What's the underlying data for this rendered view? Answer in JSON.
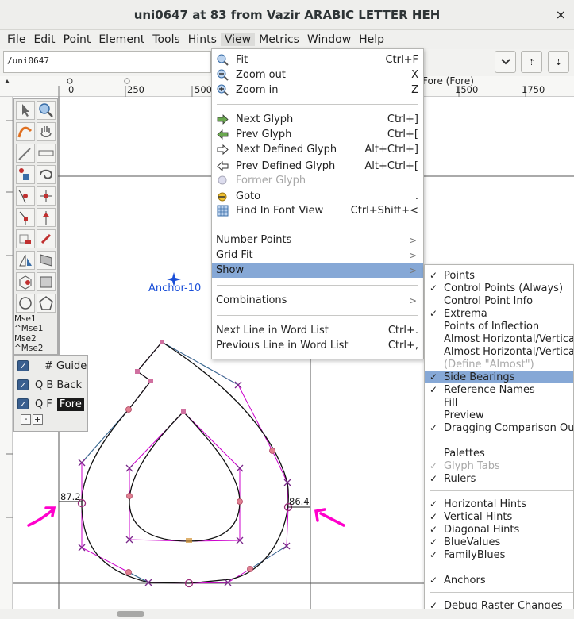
{
  "window": {
    "title": "uni0647 at 83 from Vazir ARABIC LETTER HEH",
    "close": "×"
  },
  "menubar": [
    "File",
    "Edit",
    "Point",
    "Element",
    "Tools",
    "Hints",
    "View",
    "Metrics",
    "Window",
    "Help"
  ],
  "toolbar": {
    "glyph_name": "/uni0647",
    "layer_label": "Fore (Fore)"
  },
  "ruler": {
    "top_ticks": [
      "0",
      "250",
      "500",
      "1500",
      "1750"
    ]
  },
  "palette": {
    "mse_lines": [
      "Mse1",
      "^Mse1",
      "Mse2",
      "^Mse2"
    ]
  },
  "layers": [
    {
      "label": "# Guide",
      "checked": true
    },
    {
      "label": "Q B  Back",
      "checked": true
    },
    {
      "label": "Q F",
      "tag": "Fore",
      "checked": true
    }
  ],
  "canvas": {
    "anchor_label": "Anchor-10",
    "left_bearing": "87.2",
    "right_bearing": "86.4"
  },
  "view_menu": [
    {
      "label": "Fit",
      "accel": "Ctrl+F",
      "icon": "zoom-fit-icon"
    },
    {
      "label": "Zoom out",
      "accel": "X",
      "icon": "zoom-out-icon"
    },
    {
      "label": "Zoom in",
      "accel": "Z",
      "icon": "zoom-in-icon"
    },
    {
      "label": "Next Glyph",
      "accel": "Ctrl+]",
      "icon": "next-glyph-icon"
    },
    {
      "label": "Prev Glyph",
      "accel": "Ctrl+[",
      "icon": "prev-glyph-icon"
    },
    {
      "label": "Next Defined Glyph",
      "accel": "Alt+Ctrl+]",
      "icon": "next-defined-glyph-icon"
    },
    {
      "label": "Prev Defined Glyph",
      "accel": "Alt+Ctrl+[",
      "icon": "prev-defined-glyph-icon"
    },
    {
      "label": "Former Glyph",
      "accel": "",
      "icon": "former-glyph-icon",
      "disabled": true
    },
    {
      "label": "Goto",
      "accel": ".",
      "icon": "goto-icon"
    },
    {
      "label": "Find In Font View",
      "accel": "Ctrl+Shift+<",
      "icon": "find-in-font-view-icon"
    },
    {
      "label": "Number Points",
      "submenu": true
    },
    {
      "label": "Grid Fit",
      "submenu": true
    },
    {
      "label": "Show",
      "submenu": true,
      "highlighted": true
    },
    {
      "label": "Combinations",
      "submenu": true
    },
    {
      "label": "Next Line in Word List",
      "accel": "Ctrl+."
    },
    {
      "label": "Previous Line in Word List",
      "accel": "Ctrl+,"
    }
  ],
  "show_menu": [
    {
      "label": "Points",
      "checked": true
    },
    {
      "label": "Control Points (Always)",
      "checked": true
    },
    {
      "label": "Control Point Info",
      "checked": false
    },
    {
      "label": "Extrema",
      "checked": true
    },
    {
      "label": "Points of Inflection",
      "checked": false
    },
    {
      "label": "Almost Horizontal/Vertical",
      "checked": false
    },
    {
      "label": "Almost Horizontal/Vertical",
      "checked": false
    },
    {
      "label": "(Define \"Almost\")",
      "checked": false,
      "disabled": true
    },
    {
      "label": "Side Bearings",
      "checked": true,
      "highlighted": true
    },
    {
      "label": "Reference Names",
      "checked": true
    },
    {
      "label": "Fill",
      "checked": false
    },
    {
      "label": "Preview",
      "checked": false
    },
    {
      "label": "Dragging Comparison Out",
      "checked": true
    },
    {
      "label": "Palettes",
      "checked": false
    },
    {
      "label": "Glyph Tabs",
      "checked": true,
      "disabled": true
    },
    {
      "label": "Rulers",
      "checked": true
    },
    {
      "label": "Horizontal Hints",
      "checked": true
    },
    {
      "label": "Vertical Hints",
      "checked": true
    },
    {
      "label": "Diagonal Hints",
      "checked": true
    },
    {
      "label": "BlueValues",
      "checked": true
    },
    {
      "label": "FamilyBlues",
      "checked": true
    },
    {
      "label": "Anchors",
      "checked": true
    },
    {
      "label": "Debug Raster Changes",
      "checked": true
    }
  ],
  "colors": {
    "menu_highlight": "#86a8d6",
    "outline": "#000000",
    "control_line": "#cc00cc",
    "point": "#9a2a7a",
    "annotation": "#ff00cc",
    "anchor": "#1a4fd8"
  }
}
